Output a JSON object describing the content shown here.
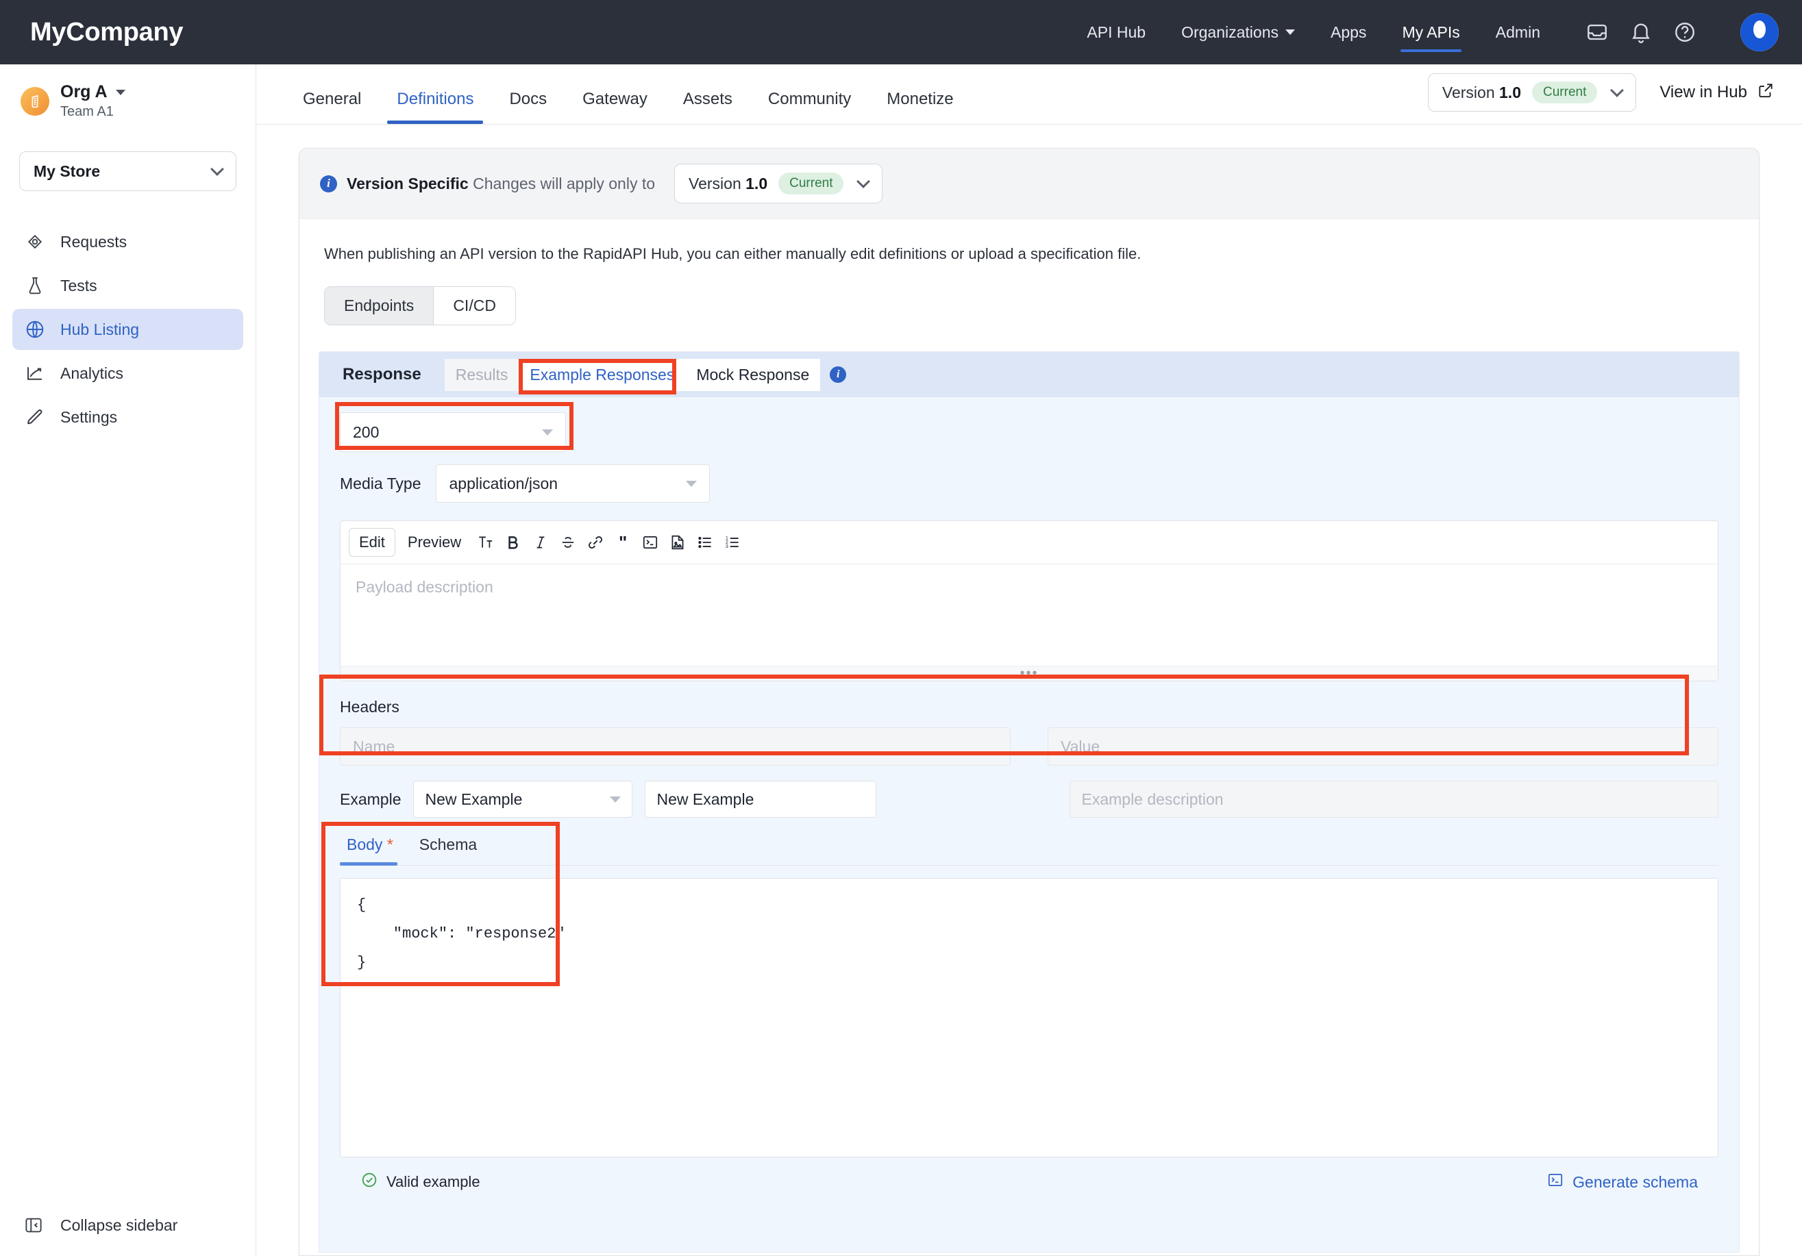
{
  "topnav": {
    "brand": "MyCompany",
    "links": [
      {
        "label": "API Hub",
        "active": false,
        "caret": false
      },
      {
        "label": "Organizations",
        "active": false,
        "caret": true
      },
      {
        "label": "Apps",
        "active": false,
        "caret": false
      },
      {
        "label": "My APIs",
        "active": true,
        "caret": false
      },
      {
        "label": "Admin",
        "active": false,
        "caret": false
      }
    ],
    "icons": [
      "inbox-icon",
      "bell-icon",
      "help-circle-icon",
      "avatar"
    ]
  },
  "sidebar": {
    "org_name": "Org A",
    "org_team": "Team A1",
    "store_label": "My Store",
    "items": [
      {
        "label": "Requests",
        "icon": "requests-icon",
        "active": false
      },
      {
        "label": "Tests",
        "icon": "flask-icon",
        "active": false
      },
      {
        "label": "Hub Listing",
        "icon": "globe-icon",
        "active": true
      },
      {
        "label": "Analytics",
        "icon": "analytics-icon",
        "active": false
      },
      {
        "label": "Settings",
        "icon": "pencil-icon",
        "active": false
      }
    ],
    "collapse_label": "Collapse sidebar"
  },
  "content_tabs": [
    {
      "label": "General",
      "active": false
    },
    {
      "label": "Definitions",
      "active": true
    },
    {
      "label": "Docs",
      "active": false
    },
    {
      "label": "Gateway",
      "active": false
    },
    {
      "label": "Assets",
      "active": false
    },
    {
      "label": "Community",
      "active": false
    },
    {
      "label": "Monetize",
      "active": false
    }
  ],
  "header_right": {
    "version_prefix": "Version",
    "version_number": "1.0",
    "version_badge": "Current",
    "view_in_hub": "View in Hub"
  },
  "version_specific": {
    "title": "Version Specific",
    "text": "Changes will apply only to",
    "version_prefix": "Version",
    "version_number": "1.0",
    "version_badge": "Current"
  },
  "note": "When publishing an API version to the RapidAPI Hub, you can either manually edit definitions or upload a specification file.",
  "segmented": [
    {
      "label": "Endpoints",
      "on": true
    },
    {
      "label": "CI/CD",
      "on": false
    }
  ],
  "response_card": {
    "title": "Response",
    "tabs": [
      {
        "label": "Results",
        "state": "muted"
      },
      {
        "label": "Example Responses",
        "state": "link"
      },
      {
        "label": "Mock Response",
        "state": "normal"
      }
    ],
    "status_code": "200",
    "media_type_label": "Media Type",
    "media_type_value": "application/json",
    "editor": {
      "edit_label": "Edit",
      "preview_label": "Preview",
      "icons": [
        "text-size-icon",
        "bold-icon",
        "italic-icon",
        "strikethrough-icon",
        "link-icon",
        "quote-icon",
        "code-block-icon",
        "image-icon",
        "bullet-list-icon",
        "numbered-list-icon"
      ],
      "placeholder": "Payload description"
    },
    "headers": {
      "label": "Headers",
      "name_placeholder": "Name",
      "value_placeholder": "Value"
    },
    "example": {
      "label": "Example",
      "select_value": "New Example",
      "name_value": "New Example",
      "description_placeholder": "Example description"
    },
    "body_tabs": [
      {
        "label": "Body",
        "required": true,
        "active": true
      },
      {
        "label": "Schema",
        "required": false,
        "active": false
      }
    ],
    "code": "{\n    \"mock\": \"response2\"\n}",
    "valid_label": "Valid example",
    "generate_schema_label": "Generate schema"
  },
  "colors": {
    "nav_bg": "#2b303b",
    "accent_blue": "#2f62c4",
    "annotation_red": "#ef4123",
    "card_bg": "#f0f6fe",
    "card_tabs_bg": "#dce6f7",
    "badge_green_bg": "#def0e2",
    "badge_green_text": "#2f7d45"
  }
}
